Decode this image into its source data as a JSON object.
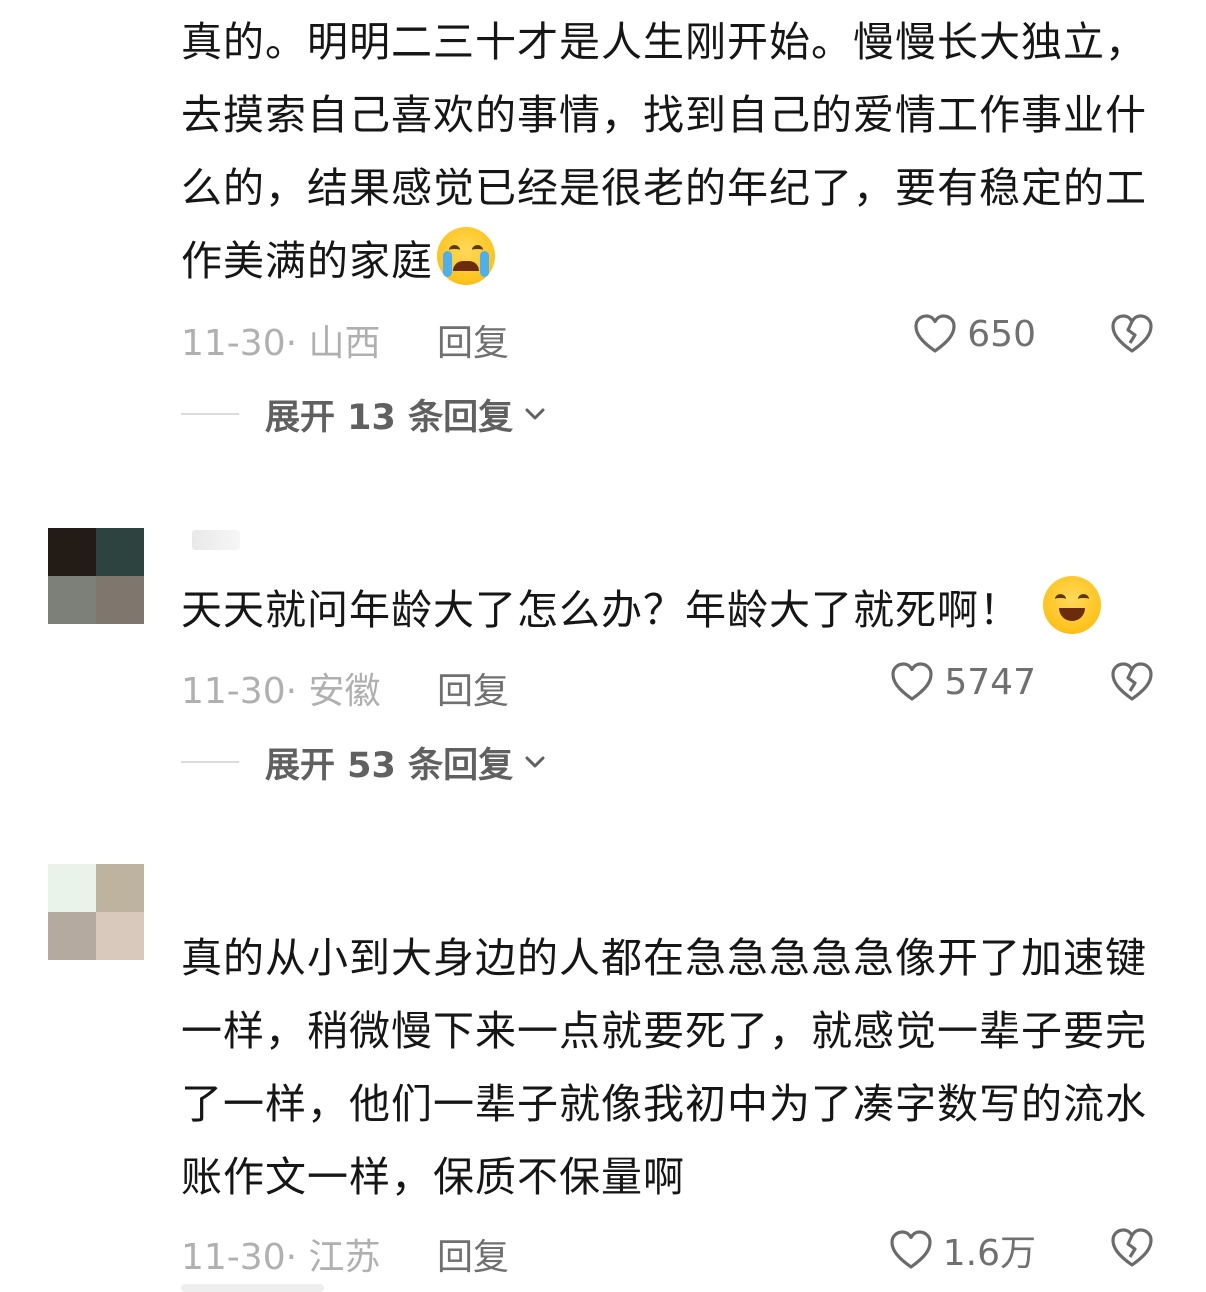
{
  "comments": [
    {
      "avatar_colors": [
        "#c9a878",
        "#4a4a4c",
        "#ffffff",
        "#ffffff"
      ],
      "text": "真的。明明二三十才是人生刚开始。慢慢长大独立，去摸索自己喜欢的事情，找到自己的爱情工作事业什么的，结果感觉已经是很老的年纪了，要有稳定的工作美满的家庭",
      "emoji": "crying-face",
      "date": "11-30·",
      "region": "山西",
      "reply_label": "回复",
      "likes": "650",
      "expand_label": "展开 13 条回复"
    },
    {
      "avatar_colors": [
        "#231c16",
        "#2d433f",
        "#7c8079",
        "#7f766e"
      ],
      "text": "天天就问年龄大了怎么办？年龄大了就死啊！",
      "emoji": "grinning-face",
      "date": "11-30·",
      "region": "安徽",
      "reply_label": "回复",
      "likes": "5747",
      "expand_label": "展开 53 条回复"
    },
    {
      "avatar_colors": [
        "#e9f3e9",
        "#bdb39f",
        "#b5aaa0",
        "#d9c8bc"
      ],
      "text": "真的从小到大身边的人都在急急急急急像开了加速键一样，稍微慢下来一点就要死了，就感觉一辈子要完了一样，他们一辈子就像我初中为了凑字数写的流水账作文一样，保质不保量啊",
      "date": "11-30·",
      "region": "江苏",
      "reply_label": "回复",
      "likes": "1.6万"
    }
  ]
}
